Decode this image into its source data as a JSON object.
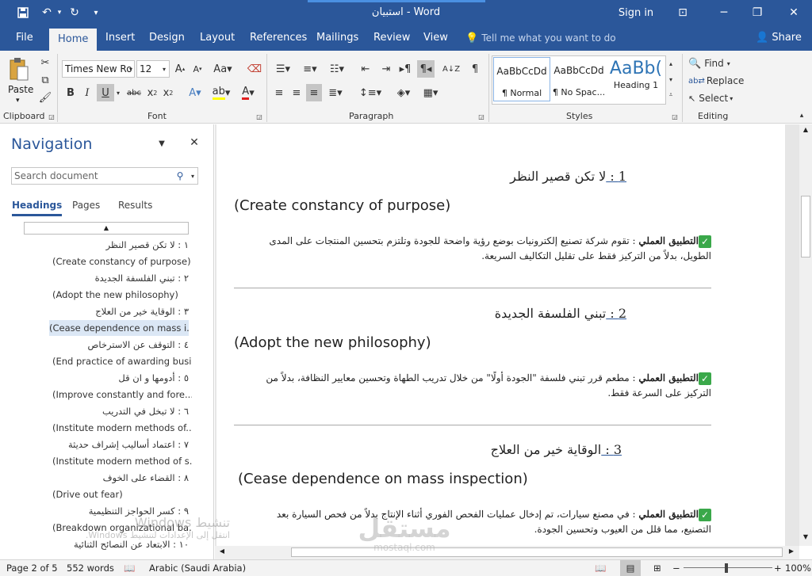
{
  "window": {
    "title": "استبيان  -  Word",
    "sign_in": "Sign in",
    "share": "Share"
  },
  "tabs": [
    "File",
    "Home",
    "Insert",
    "Design",
    "Layout",
    "References",
    "Mailings",
    "Review",
    "View"
  ],
  "tell_me": "Tell me what you want to do",
  "ribbon": {
    "paste": "Paste",
    "clipboard": "Clipboard",
    "font_name": "Times New Ro",
    "font_size": "12",
    "font": "Font",
    "paragraph": "Paragraph",
    "styles_label": "Styles",
    "editing": "Editing",
    "find": "Find",
    "replace": "Replace",
    "select": "Select",
    "styles": [
      {
        "sample": "AaBbCcDd",
        "name": "¶ Normal"
      },
      {
        "sample": "AaBbCcDd",
        "name": "¶ No Spac..."
      },
      {
        "sample": "AaBb(",
        "name": "Heading 1"
      }
    ]
  },
  "nav": {
    "title": "Navigation",
    "search_placeholder": "Search document",
    "tabs": [
      "Headings",
      "Pages",
      "Results"
    ],
    "items": [
      "١ : لا تكن قصير النظر",
      "(Create constancy of purpose)",
      "٢ : تبني الفلسفة الجديدة",
      "(Adopt the new philosophy)",
      "٣ : الوقاية خير من العلاج",
      "(Cease dependence on mass i...",
      "٤ : التوقف عن الاسترخاص",
      "(End practice of awarding busi...",
      "٥ : أدومها و ان قل",
      "(Improve constantly and fore...",
      "٦ : لا تبخل في التدريب",
      "(Institute modern methods of...",
      "٧ : اعتماد أساليب إشراف حديثة",
      "(Institute modern method of s...",
      "٨ : القضاء على الخوف",
      "(Drive out fear)",
      "٩ : كسر الحواجز التنظيمية",
      "(Breakdown organizational ba...",
      "١٠ : الابتعاد عن النصائح الثنائية"
    ]
  },
  "doc": {
    "sections": [
      {
        "num": "1",
        "heading": "لا تكن قصير النظر",
        "english": "(Create constancy of purpose)",
        "label": "التطبيق العملي",
        "text": ": تقوم شركة تصنيع إلكترونيات بوضع رؤية واضحة للجودة وتلتزم بتحسين المنتجات على المدى الطويل، بدلاً من التركيز فقط على تقليل التكاليف السريعة."
      },
      {
        "num": "2",
        "heading": "تبني الفلسفة الجديدة",
        "english": "(Adopt the new philosophy)",
        "label": "التطبيق العملي",
        "text": ": مطعم قرر تبني فلسفة \"الجودة أولًا\" من خلال تدريب الطهاة وتحسين معايير النظافة، بدلاً من التركيز على السرعة فقط."
      },
      {
        "num": "3",
        "heading": "الوقاية خير من العلاج",
        "english": "(Cease dependence on mass inspection)",
        "label": "التطبيق العملي",
        "text": ": في مصنع سيارات، تم إدخال عمليات الفحص الفوري أثناء الإنتاج بدلاً من فحص السيارة بعد التصنيع، مما قلل من العيوب وتحسين الجودة."
      }
    ]
  },
  "status": {
    "page": "Page 2 of 5",
    "words": "552 words",
    "language": "Arabic (Saudi Arabia)",
    "zoom": "100%"
  },
  "watermark": {
    "line1": "تنشيط Windows",
    "line2": "انتقل إلى الإعدادات لتنشيط Windows.",
    "brand": "مستقل",
    "brand_url": "mostaql.com"
  }
}
